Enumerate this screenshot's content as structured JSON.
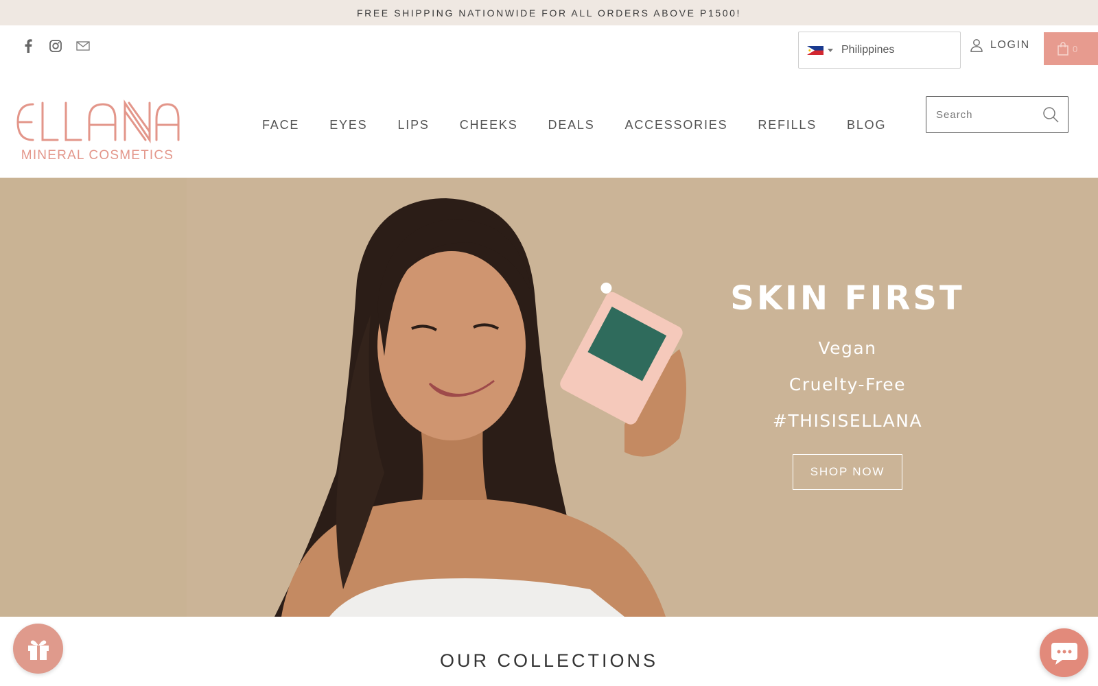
{
  "announcement": {
    "text": "FREE SHIPPING NATIONWIDE FOR ALL ORDERS ABOVE P1500!"
  },
  "social": {
    "icons": [
      "facebook-icon",
      "instagram-icon",
      "email-icon"
    ]
  },
  "country_selector": {
    "value": "Philippines",
    "flag": "ph-flag-icon"
  },
  "account": {
    "login_label": "LOGIN"
  },
  "cart": {
    "count": "0"
  },
  "brand": {
    "name": "ELLANA",
    "tagline": "MINERAL COSMETICS",
    "color": "#e3968a"
  },
  "nav": {
    "items": [
      "FACE",
      "EYES",
      "LIPS",
      "CHEEKS",
      "DEALS",
      "ACCESSORIES",
      "REFILLS",
      "BLOG"
    ]
  },
  "search": {
    "placeholder": "Search",
    "value": ""
  },
  "hero": {
    "headline": "SKIN FIRST",
    "lines": [
      "Vegan",
      "Cruelty-Free",
      "#THISISELLANA"
    ],
    "cta_label": "SHOP NOW",
    "background": "#cbb497"
  },
  "collections": {
    "heading": "OUR COLLECTIONS"
  },
  "colors": {
    "accent": "#e79b8f",
    "announcement_bg": "#efe8e2"
  }
}
